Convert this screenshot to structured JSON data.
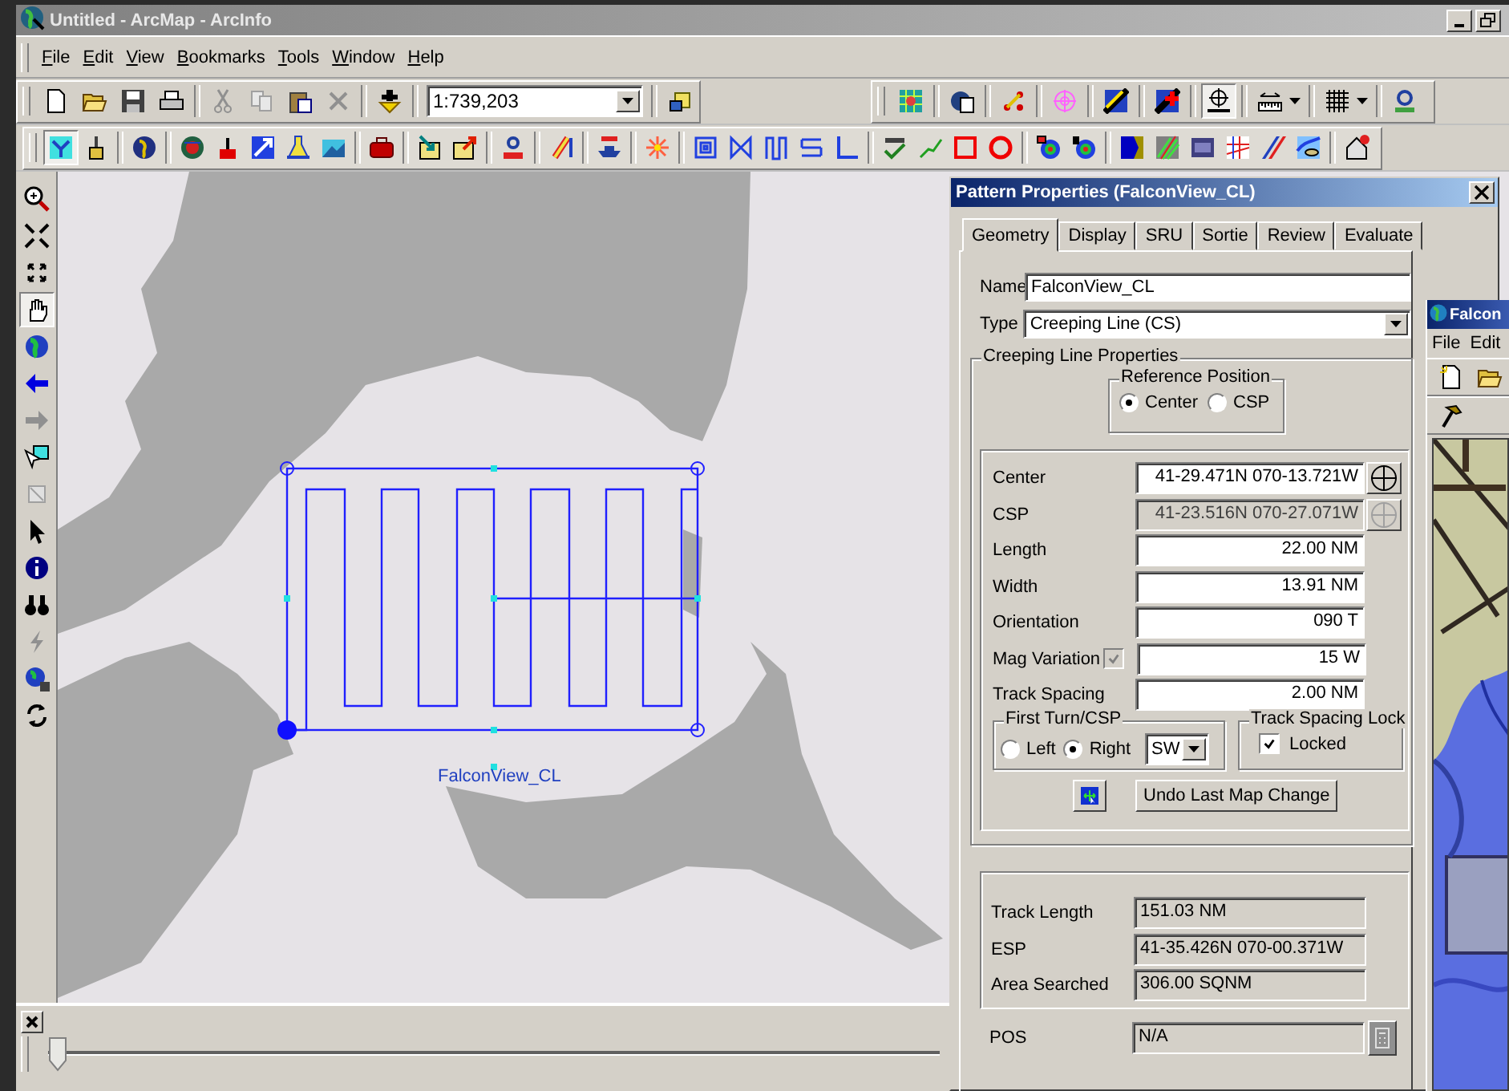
{
  "window": {
    "title": "Untitled - ArcMap - ArcInfo"
  },
  "menu": [
    "File",
    "Edit",
    "View",
    "Bookmarks",
    "Tools",
    "Window",
    "Help"
  ],
  "standard_toolbar": {
    "scale": "1:739,203"
  },
  "search_toolbar": [
    {
      "selected": false
    },
    {
      "selected": false
    },
    {
      "selected": false
    },
    {
      "selected": false
    },
    {
      "selected": false
    },
    {
      "selected": false
    },
    {
      "selected": true
    },
    {
      "selected": false
    },
    {
      "selected": false
    },
    {
      "selected": false
    }
  ],
  "pattern_toolbar": [
    {
      "selected": true
    },
    {
      "selected": false
    },
    {
      "selected": false
    },
    {
      "selected": false
    },
    {
      "selected": false
    },
    {
      "selected": false
    },
    {
      "selected": false
    },
    {
      "selected": false
    },
    {
      "selected": false
    },
    {
      "selected": false
    },
    {
      "selected": false
    },
    {
      "selected": false
    },
    {
      "selected": false
    },
    {
      "selected": false
    },
    {
      "selected": false
    },
    {
      "selected": false
    },
    {
      "selected": false
    },
    {
      "selected": false
    },
    {
      "selected": false
    },
    {
      "selected": false
    },
    {
      "selected": false
    },
    {
      "selected": false
    },
    {
      "selected": false
    },
    {
      "selected": false
    },
    {
      "selected": false
    },
    {
      "selected": false
    },
    {
      "selected": false
    },
    {
      "selected": false
    },
    {
      "selected": false
    },
    {
      "selected": false
    },
    {
      "selected": false
    },
    {
      "selected": false
    },
    {
      "selected": false
    }
  ],
  "tools_toolbar": [
    {
      "selected": false
    },
    {
      "selected": false
    },
    {
      "selected": false
    },
    {
      "selected": true
    },
    {
      "selected": false
    },
    {
      "selected": false
    },
    {
      "selected": false
    },
    {
      "selected": false
    },
    {
      "selected": false
    },
    {
      "selected": false
    },
    {
      "selected": false
    },
    {
      "selected": false
    },
    {
      "selected": false
    },
    {
      "selected": false
    },
    {
      "selected": false
    }
  ],
  "map": {
    "label": "FalconView_CL"
  },
  "time_slider": {
    "level": 0
  },
  "dialog": {
    "title": "Pattern Properties (FalconView_CL)",
    "tabs": [
      {
        "label": "Geometry",
        "selected": true
      },
      {
        "label": "Display",
        "selected": false
      },
      {
        "label": "SRU",
        "selected": false
      },
      {
        "label": "Sortie",
        "selected": false
      },
      {
        "label": "Review",
        "selected": false
      },
      {
        "label": "Evaluate",
        "selected": false
      }
    ],
    "name": {
      "label": "Name",
      "value": "FalconView_CL"
    },
    "type": {
      "label": "Type",
      "value": "Creeping Line (CS)"
    },
    "properties": {
      "title": "Creeping Line Properties",
      "reference_position": {
        "title": "Reference Position",
        "options": [
          {
            "label": "Center",
            "selected": true
          },
          {
            "label": "CSP",
            "selected": false
          }
        ]
      },
      "rows": [
        {
          "kind": "position",
          "label": "Center",
          "value": "41-29.471N 070-13.721W",
          "disabled": false
        },
        {
          "kind": "position",
          "label": "CSP",
          "value": "41-23.516N 070-27.071W",
          "disabled": true
        },
        {
          "kind": "measure",
          "label": "Length",
          "value": "22.00 NM",
          "disabled": false
        },
        {
          "kind": "measure",
          "label": "Width",
          "value": "13.91 NM",
          "disabled": false
        },
        {
          "kind": "measure",
          "label": "Orientation",
          "value": "090 T",
          "disabled": false
        },
        {
          "kind": "checked_measure",
          "label": "Mag Variation",
          "value": "15 W",
          "disabled": false,
          "checked": true,
          "check_disabled": true
        },
        {
          "kind": "measure",
          "label": "Track Spacing",
          "value": "2.00 NM",
          "disabled": false
        }
      ],
      "first_turn": {
        "title": "First Turn/CSP",
        "options": [
          {
            "label": "Left",
            "selected": false
          },
          {
            "label": "Right",
            "selected": true
          }
        ],
        "direction": "SW"
      },
      "spacing_lock": {
        "title": "Track Spacing Lock",
        "label": "Locked",
        "checked": true
      },
      "undo_button": "Undo Last Map Change"
    },
    "results": [
      {
        "label": "Track Length",
        "value": "151.03 NM"
      },
      {
        "label": "ESP",
        "value": "41-35.426N 070-00.371W"
      },
      {
        "label": "Area Searched",
        "value": "306.00 SQNM"
      }
    ],
    "pos": {
      "label": "POS",
      "value": "N/A",
      "disabled": true
    }
  },
  "falconview": {
    "title": "Falcon",
    "menu": [
      "File",
      "Edit"
    ]
  }
}
